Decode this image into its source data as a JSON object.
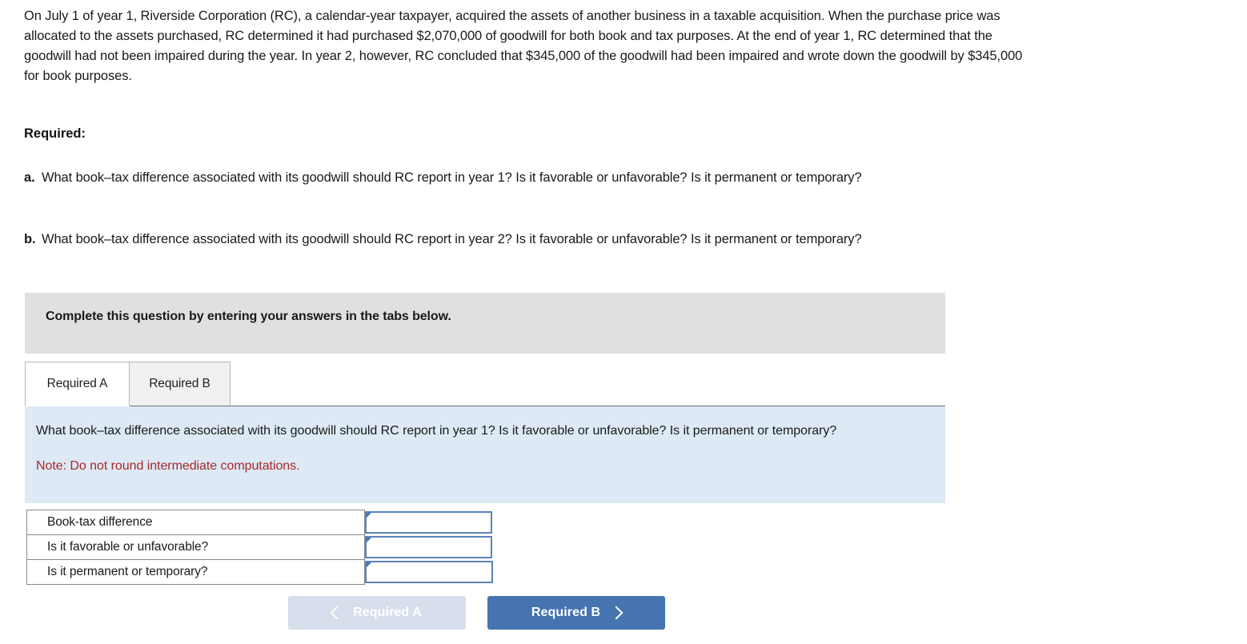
{
  "problem": {
    "stem": "On July 1 of year 1, Riverside Corporation (RC), a calendar-year taxpayer, acquired the assets of another business in a taxable acquisition. When the purchase price was allocated to the assets purchased, RC determined it had purchased $2,070,000 of goodwill for both book and tax purposes. At the end of year 1, RC determined that the goodwill had not been impaired during the year. In year 2, however, RC concluded that $345,000 of the goodwill had been impaired and wrote down the goodwill by $345,000 for book purposes.",
    "required_heading": "Required:",
    "items": [
      {
        "marker": "a.",
        "text": "What book–tax difference associated with its goodwill should RC report in year 1? Is it favorable or unfavorable? Is it permanent or temporary?"
      },
      {
        "marker": "b.",
        "text": "What book–tax difference associated with its goodwill should RC report in year 2? Is it favorable or unfavorable? Is it permanent or temporary?"
      }
    ]
  },
  "instruction_bar": {
    "text": "Complete this question by entering your answers in the tabs below."
  },
  "tabs": [
    {
      "label": "Required A",
      "active": true
    },
    {
      "label": "Required B",
      "active": false
    }
  ],
  "question_panel": {
    "question": "What book–tax difference associated with its goodwill should RC report in year 1? Is it favorable or unfavorable? Is it permanent or temporary?",
    "note": "Note: Do not round intermediate computations.",
    "note_color": "#a52a2a",
    "background_color": "#dde9f4"
  },
  "answer_table": {
    "rows": [
      {
        "label": "Book-tax difference",
        "value": "",
        "placeholder": ""
      },
      {
        "label": "Is it favorable or unfavorable?",
        "value": "",
        "placeholder": ""
      },
      {
        "label": "Is it permanent or temporary?",
        "value": "",
        "placeholder": ""
      }
    ]
  },
  "nav": {
    "prev_label": "Required A",
    "next_label": "Required B",
    "prev_icon": "chevron-left-icon",
    "next_icon": "chevron-right-icon",
    "prev_disabled": true,
    "accent_color": "#4574b0",
    "disabled_color": "#d6dfeb"
  }
}
